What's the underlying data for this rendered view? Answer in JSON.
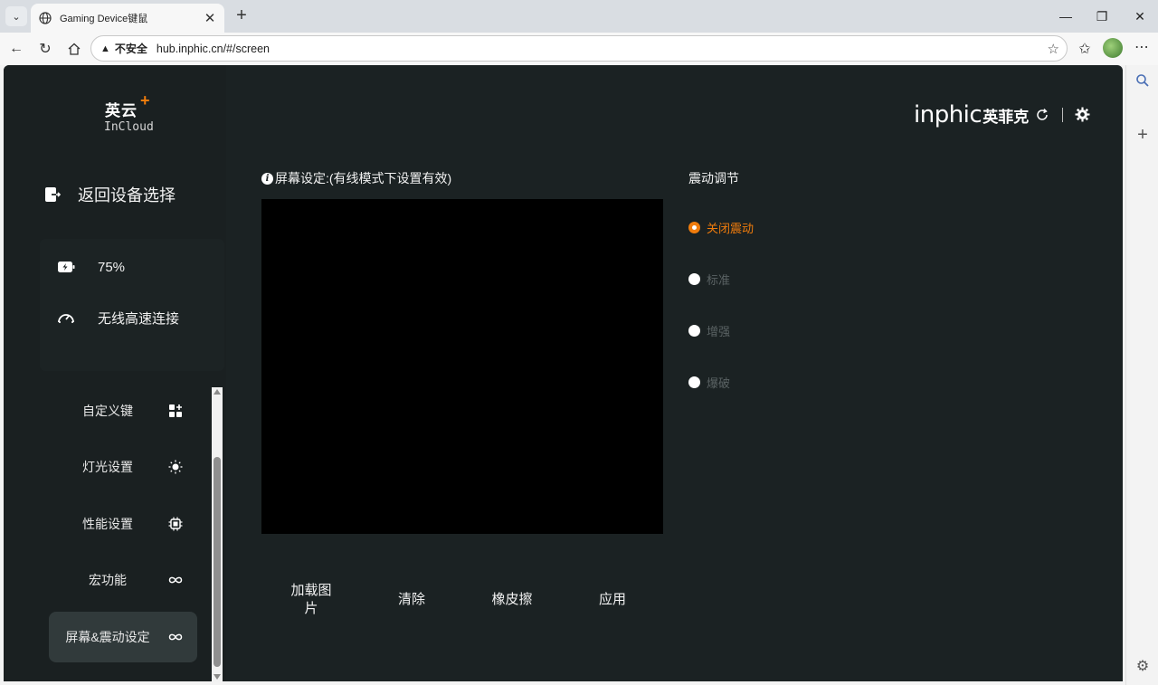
{
  "browser": {
    "tab_title": "Gaming Device键鼠",
    "insecure_label": "不安全",
    "url": "hub.inphic.cn/#/screen"
  },
  "app": {
    "logo_cn": "英云",
    "logo_plus": "+",
    "logo_en": "InCloud",
    "brand_en": "inphic",
    "brand_cn": "英菲克",
    "accent_color": "#f07c0c",
    "background_color": "#1b2223"
  },
  "sidebar": {
    "back_label": "返回设备选择",
    "battery": "75%",
    "connection": "无线高速连接",
    "menu": [
      {
        "label": "自定义键",
        "icon": "apps-icon"
      },
      {
        "label": "灯光设置",
        "icon": "sun-icon"
      },
      {
        "label": "性能设置",
        "icon": "chip-icon"
      },
      {
        "label": "宏功能",
        "icon": "infinity-icon"
      },
      {
        "label": "屏幕&震动设定",
        "icon": "infinity-icon",
        "active": true
      }
    ]
  },
  "screen": {
    "title": "屏幕设定:(有线模式下设置有效)",
    "buttons": {
      "load_image": "加载图片",
      "clear": "清除",
      "eraser": "橡皮擦",
      "apply": "应用"
    }
  },
  "vibration": {
    "title": "震动调节",
    "options": [
      {
        "label": "关闭震动",
        "selected": true
      },
      {
        "label": "标准",
        "selected": false
      },
      {
        "label": "增强",
        "selected": false
      },
      {
        "label": "爆破",
        "selected": false
      }
    ]
  }
}
